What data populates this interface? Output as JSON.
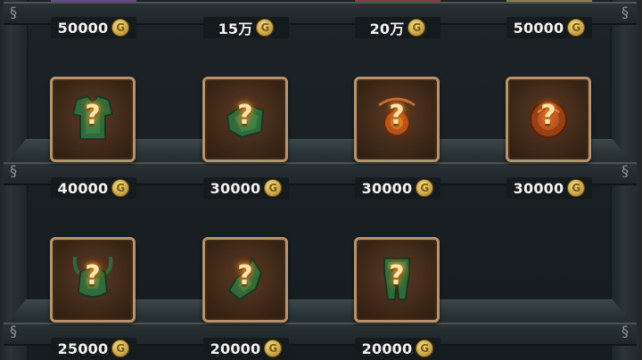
{
  "currency_icon": "gold-coin-icon",
  "coin_symbol": "G",
  "top_row": [
    {
      "price": "50000",
      "peek_color": "#6a4b8a"
    },
    {
      "price": "15万",
      "peek_color": ""
    },
    {
      "price": "20万",
      "peek_color": "#8a3a44"
    },
    {
      "price": "50000",
      "peek_color": "#8a7a55"
    }
  ],
  "row1": [
    {
      "icon": "green-armor-icon",
      "glow": "#2f6b3a",
      "price": "40000"
    },
    {
      "icon": "green-bracer-icon",
      "glow": "#2f6b3a",
      "price": "30000"
    },
    {
      "icon": "orange-amulet-icon",
      "glow": "#b8531a",
      "price": "30000"
    },
    {
      "icon": "orange-ring-icon",
      "glow": "#b8531a",
      "price": "30000"
    }
  ],
  "row2": [
    {
      "icon": "horned-helmet-icon",
      "glow": "#2f6b3a",
      "price": "25000"
    },
    {
      "icon": "green-gauntlet-icon",
      "glow": "#2f6b3a",
      "price": "20000"
    },
    {
      "icon": "green-leggings-icon",
      "glow": "#2f6b3a",
      "price": "20000"
    }
  ]
}
